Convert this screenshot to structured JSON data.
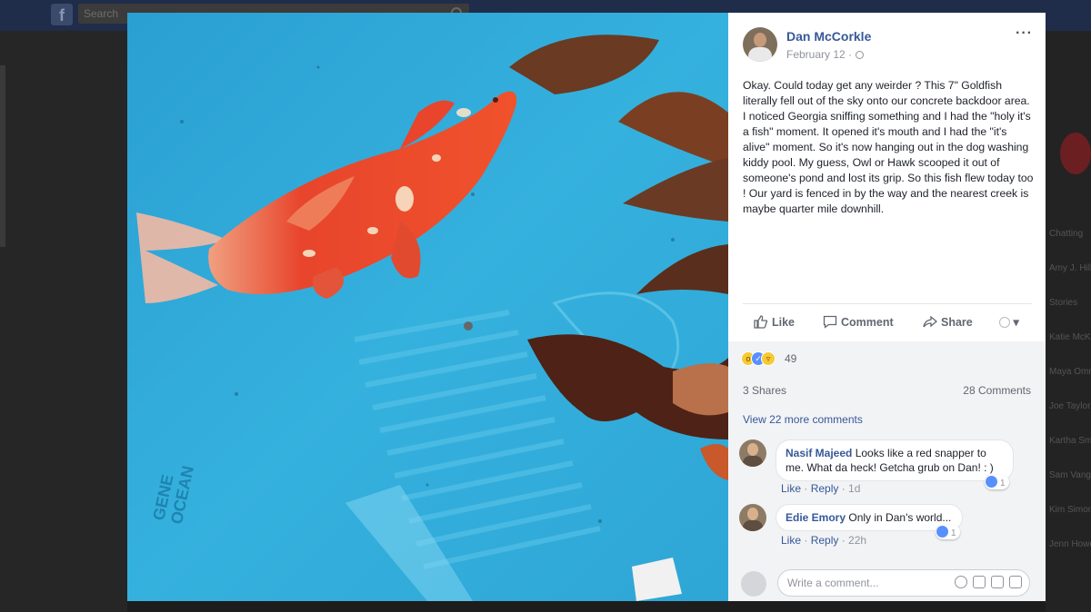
{
  "background": {
    "search_placeholder": "Search",
    "chat_names": [
      "Chatting",
      "Amy J. Hill",
      "Stories",
      "Katie McK",
      "Maya Omni",
      "Joe Taylor",
      "Kartha Smi",
      "Sam Vang",
      "Kim Simon",
      "Jenn Howe"
    ]
  },
  "post": {
    "author": "Dan McCorkle",
    "date": "February 12 ·",
    "text": "Okay. Could today get any weirder ? This 7\" Goldfish literally fell out of the sky onto our concrete backdoor area. I noticed Georgia sniffing something and I had the \"holy       it's a fish\" moment. It opened it's mouth and I had the \"it's alive\" moment. So it's now hanging out in the dog washing kiddy pool. My guess, Owl or Hawk scooped it out of someone's pond and lost its grip. So this fish flew today too ! Our yard is fenced in by the way and the nearest creek is maybe quarter mile downhill.",
    "more_label": "···"
  },
  "actions": {
    "like": "Like",
    "comment": "Comment",
    "share": "Share",
    "audience": "▾"
  },
  "stats": {
    "reaction_count": "49",
    "reaction_icons": [
      "wow",
      "like",
      "haha"
    ],
    "shares": "3 Shares",
    "comments": "28 Comments",
    "view_more": "View 22 more comments"
  },
  "comments": [
    {
      "name": "Nasif Majeed",
      "text_line1": "Looks like a red snapper to",
      "text_line2": "me. What da heck! Getcha grub on Dan! : )",
      "like": "Like",
      "reply": "Reply",
      "time": "1d",
      "reactions": "1"
    },
    {
      "name": "Edie Emory",
      "text_line1": "Only in Dan's world...",
      "like": "Like",
      "reply": "Reply",
      "time": "22h",
      "reactions": "1"
    }
  ],
  "composer": {
    "placeholder": "Write a comment..."
  },
  "colors": {
    "link": "#365899",
    "pool_water": "#2fa8d8",
    "goldfish": "#e8432a"
  }
}
